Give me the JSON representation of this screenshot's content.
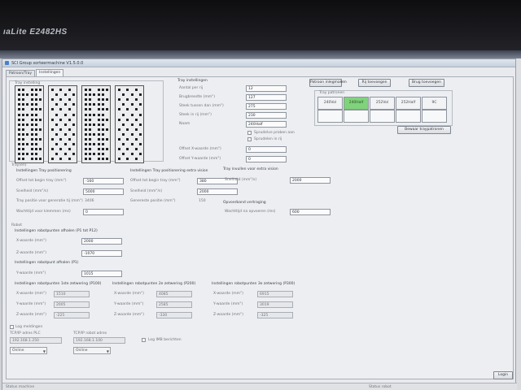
{
  "monitor": {
    "brand": "ıaLite E2482HS"
  },
  "window": {
    "title": "SCI Group sorteermachine V1.5.0.0"
  },
  "tabs": [
    {
      "label": "Patroon/Tray"
    },
    {
      "label": "Instellingen"
    }
  ],
  "tray_instelling": {
    "label": "Tray instelling"
  },
  "tray_settings": {
    "title": "Tray instellingen",
    "fields": [
      {
        "label": "Aantal per rij",
        "value": "12"
      },
      {
        "label": "Brugbreedte (mm\")",
        "value": "127"
      },
      {
        "label": "Steek tussen dan (mm\")",
        "value": "275"
      },
      {
        "label": "Steek in rij (mm\")",
        "value": "230"
      },
      {
        "label": "Naam",
        "value": "240Half"
      }
    ],
    "checkboxes": [
      "Sprudelve proben aan",
      "Sprudelen in rij"
    ],
    "offset_x_label": "Offset X-waarde (mm\")",
    "offset_x_value": "0",
    "offset_y_label": "Offset Y-waarde (mm\")",
    "offset_y_value": "0"
  },
  "buttons": {
    "patroon": "Patroon inlegmaken",
    "rij": "Rij toevoegen",
    "brug": "Brug toevoegen",
    "bewaar": "Bewaar traypatronen"
  },
  "tray_patronen": {
    "title": "Tray patronen",
    "items": [
      "240Vol",
      "240Half",
      "252Vol",
      "252Half",
      "9C"
    ],
    "selected": "240Half"
  },
  "tray_section": {
    "label": "Tray(en)"
  },
  "positionering": {
    "title": "Instellingen Tray positionering",
    "offset_label": "Offset tot begin tray (mm\")",
    "offset_value": "-160",
    "snelheid_label": "Snelheid (mm\"/s)",
    "snelheid_value": "5000",
    "gen_label": "Tray positie voor generatie tij (mm\")",
    "gen_value": "3406",
    "wacht_label": "Wachttijd voor klemmen (ms)",
    "wacht_value": "0"
  },
  "extra_vision": {
    "title": "Instellingen Tray positionering extra vision",
    "offset_label": "Offset tot begin tray (mm\")",
    "offset_value": "380",
    "snelheid_label": "Snelheid (mm\"/s)",
    "snelheid_value": "2000",
    "gen_label": "Genereste positie (mm\")",
    "gen_value": "150"
  },
  "extra_vision2": {
    "title": "Tray invullen voor extra vision",
    "snelheid_label": "Snelheid (mm\"/s)",
    "snelheid_value": "2000"
  },
  "opvoerband": {
    "title": "Opvoerband vertraging",
    "label": "Wachttijd na opvoeren (ms)",
    "value": "600"
  },
  "robot": {
    "label": "Robot",
    "afhalen_title": "Instellingen robotpunten afhalen (P1 tot P12)",
    "x_label": "X-waarde (mm\")",
    "x_value": "2000",
    "z_label": "Z-waarde (mm\")",
    "z_value": "-1070",
    "afhalen2_title": "Instellingen robotpunt afhalen (P1)",
    "y_label": "Y-waarde (mm\")",
    "y_value": "1015"
  },
  "zetting": [
    {
      "title": "Instellingen robotpunten 1ste zetwering (P100)",
      "x": "1510",
      "y": "2005",
      "z": "-225"
    },
    {
      "title": "Instellingen robotpunten 2e zetwering (P200)",
      "x": "4085",
      "y": "2585",
      "z": "-330"
    },
    {
      "title": "Instellingen robotpunten 3e zetwering (P300)",
      "x": "6915",
      "y": "3019",
      "z": "-325"
    }
  ],
  "zetting_labels": {
    "x": "X-waarde (mm\")",
    "y": "Y-waarde (mm\")",
    "z": "Z-waarde (mm\")"
  },
  "log": {
    "label": "Log meldingen"
  },
  "tcp": {
    "adres_label": "TCP/IP adres PLC",
    "adres_value": "192.168.1.250",
    "robot_label": "TCP/IP robot adres",
    "robot_value": "192.168.1.100",
    "check_label": "Log IMB berichten",
    "plc_status": "Online",
    "robot_status": "Online"
  },
  "login_button": "Login",
  "statusbar": {
    "left": "Status machine",
    "right": "Status robot"
  }
}
